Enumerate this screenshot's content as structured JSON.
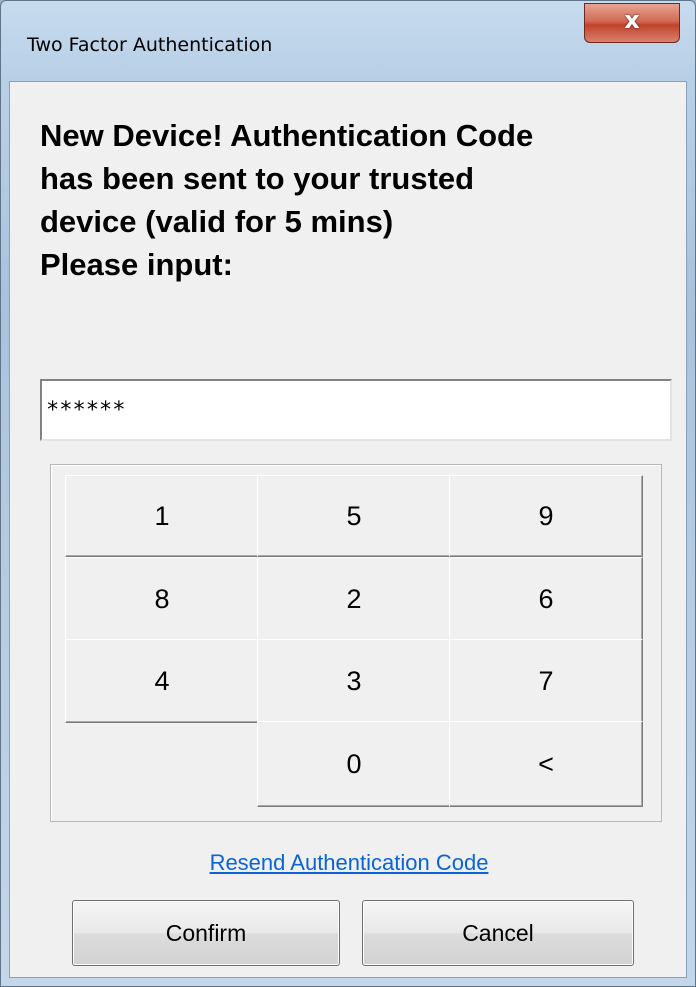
{
  "window": {
    "title": "Two Factor Authentication",
    "close_label": "x"
  },
  "message": {
    "lines": [
      "New Device! Authentication Code",
      "has been sent to your trusted",
      "device (valid for 5 mins)",
      "Please input:"
    ]
  },
  "code_input": {
    "value": "******"
  },
  "keypad": {
    "keys": [
      "1",
      "5",
      "9",
      "8",
      "2",
      "6",
      "4",
      "3",
      "7",
      "0",
      "<"
    ]
  },
  "resend_link": "Resend Authentication Code",
  "buttons": {
    "confirm": "Confirm",
    "cancel": "Cancel"
  }
}
